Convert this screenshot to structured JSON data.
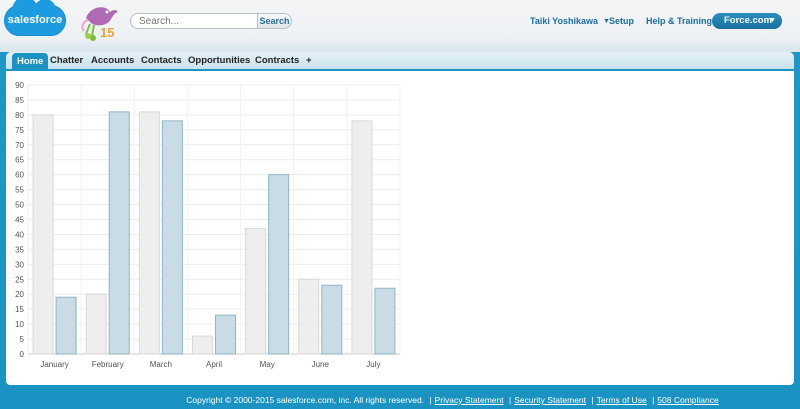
{
  "header": {
    "logo_text": "salesforce",
    "anniversary_badge": "15",
    "search": {
      "placeholder": "Search...",
      "button_label": "Search"
    },
    "user_name": "Taiki Yoshikawa",
    "setup_label": "Setup",
    "help_label": "Help & Training",
    "app_menu_label": "Force.com"
  },
  "tabs": [
    {
      "label": "Home",
      "active": true
    },
    {
      "label": "Chatter"
    },
    {
      "label": "Accounts"
    },
    {
      "label": "Contacts"
    },
    {
      "label": "Opportunities"
    },
    {
      "label": "Contracts"
    },
    {
      "label": "+"
    }
  ],
  "chart_data": {
    "type": "bar",
    "categories": [
      "January",
      "February",
      "March",
      "April",
      "May",
      "June",
      "July"
    ],
    "series": [
      {
        "values": [
          80,
          20,
          81,
          6,
          42,
          25,
          78
        ],
        "color": "#eeeeee"
      },
      {
        "values": [
          19,
          81,
          78,
          13,
          60,
          23,
          22
        ],
        "color": "#c9dce5"
      }
    ],
    "ylim": [
      0,
      90
    ],
    "yticks": [
      0,
      5,
      10,
      15,
      20,
      25,
      30,
      35,
      40,
      45,
      50,
      55,
      60,
      65,
      70,
      75,
      80,
      85,
      90
    ],
    "grid": true
  },
  "footer": {
    "copyright": "Copyright © 2000-2015 salesforce.com, inc. All rights reserved.",
    "links": [
      "Privacy Statement",
      "Security Statement",
      "Terms of Use",
      "508 Compliance"
    ]
  },
  "colors": {
    "brand_blue": "#1a93c3",
    "link_blue": "#1a6fa0",
    "bar_light": "#eeeeee",
    "bar_blue": "#c9dce5"
  }
}
